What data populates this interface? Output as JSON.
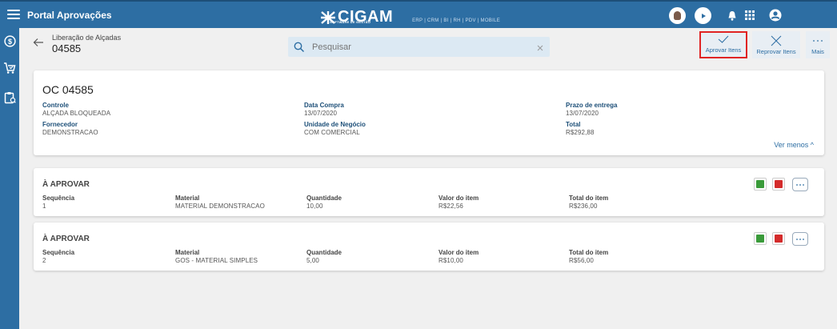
{
  "topbar": {
    "title": "Portal Aprovações",
    "logo": "CIGAM",
    "logo_sub": "SOFTWARE DE GESTÃO",
    "logo_products": "ERP | CRM | BI | RH | PDV | MOBILE"
  },
  "sidebar": {
    "items": [
      "dollar-icon",
      "cart-icon",
      "clipboard-icon"
    ]
  },
  "header": {
    "breadcrumb": "Liberação de Alçadas",
    "doc_number": "04585"
  },
  "search": {
    "placeholder": "Pesquisar"
  },
  "actions": {
    "approve": "Aprovar Itens",
    "reject": "Reprovar Itens",
    "more": "Mais"
  },
  "order": {
    "title": "OC 04585",
    "fields": [
      {
        "label": "Controle",
        "value": "ALÇADA BLOQUEADA"
      },
      {
        "label": "Fornecedor",
        "value": "DEMONSTRACAO"
      },
      {
        "label": "Data Compra",
        "value": "13/07/2020"
      },
      {
        "label": "Unidade de Negócio",
        "value": "COM COMERCIAL"
      },
      {
        "label": "Prazo de entrega",
        "value": "13/07/2020"
      },
      {
        "label": "Total",
        "value": "R$292,88"
      }
    ],
    "toggle": "Ver menos ^"
  },
  "items": [
    {
      "status": "À APROVAR",
      "headers": [
        "Sequência",
        "Material",
        "Quantidade",
        "Valor do item",
        "Total do item"
      ],
      "values": [
        "1",
        "MATERIAL DEMONSTRACAO",
        "10,00",
        "R$22,56",
        "R$236,00"
      ]
    },
    {
      "status": "À APROVAR",
      "headers": [
        "Sequência",
        "Material",
        "Quantidade",
        "Valor do item",
        "Total do item"
      ],
      "values": [
        "2",
        "GOS - MATERIAL SIMPLES",
        "5,00",
        "R$10,00",
        "R$56,00"
      ]
    }
  ],
  "colors": {
    "brand": "#2d6ea3",
    "highlight_border": "#e02424",
    "approve": "#3a9b3a",
    "reject": "#d42b2b"
  }
}
